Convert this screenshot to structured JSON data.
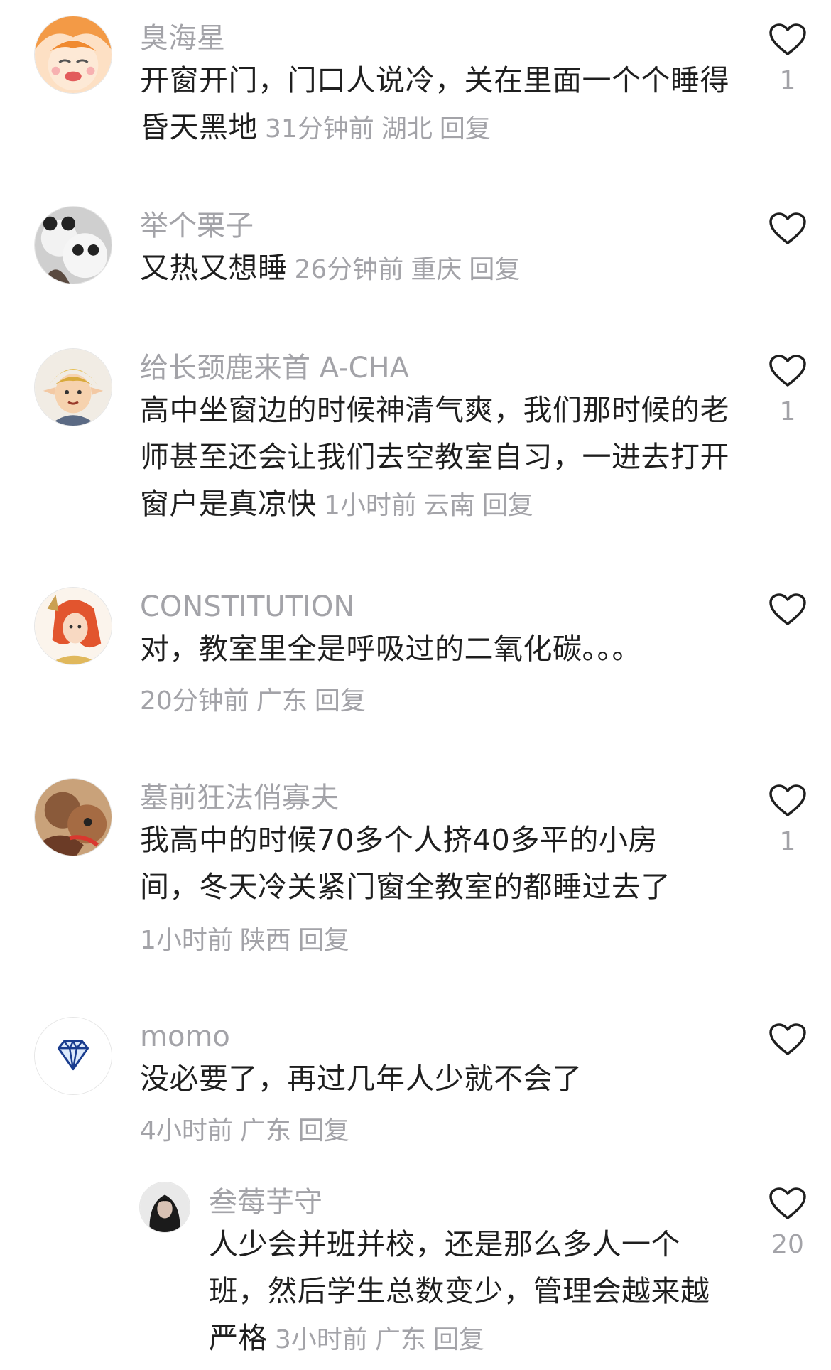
{
  "comments": [
    {
      "username": "臭海星",
      "text": "开窗开门，门口人说冷，关在里面一个个睡得昏天黑地",
      "time": "31分钟前",
      "location": "湖北",
      "reply": "回复",
      "likes": "1"
    },
    {
      "username": "举个栗子",
      "text": "又热又想睡",
      "time": "26分钟前",
      "location": "重庆",
      "reply": "回复",
      "likes": ""
    },
    {
      "username": "给长颈鹿来首 A-CHA",
      "text": "高中坐窗边的时候神清气爽，我们那时候的老师甚至还会让我们去空教室自习，一进去打开窗户是真凉快",
      "time": "1小时前",
      "location": "云南",
      "reply": "回复",
      "likes": "1"
    },
    {
      "username": "CONSTITUTION",
      "text": "对，教室里全是呼吸过的二氧化碳。。。",
      "time": "20分钟前",
      "location": "广东",
      "reply": "回复",
      "likes": ""
    },
    {
      "username": "墓前狂法俏寡夫",
      "text": "我高中的时候70多个人挤40多平的小房间，冬天冷关紧门窗全教室的都睡过去了",
      "time": "1小时前",
      "location": "陕西",
      "reply": "回复",
      "likes": "1"
    },
    {
      "username": "momo",
      "text": "没必要了，再过几年人少就不会了",
      "time": "4小时前",
      "location": "广东",
      "reply": "回复",
      "likes": ""
    },
    {
      "username": "叁莓芋守",
      "text": "人少会并班并校，还是那么多人一个班，然后学生总数变少，管理会越来越严格",
      "time": "3小时前",
      "location": "广东",
      "reply": "回复",
      "likes": "20"
    }
  ],
  "colors": {
    "text": "#1f1f1f",
    "meta": "#a3a3a8",
    "background": "#ffffff"
  },
  "icons": {
    "like": "heart-outline-icon"
  }
}
